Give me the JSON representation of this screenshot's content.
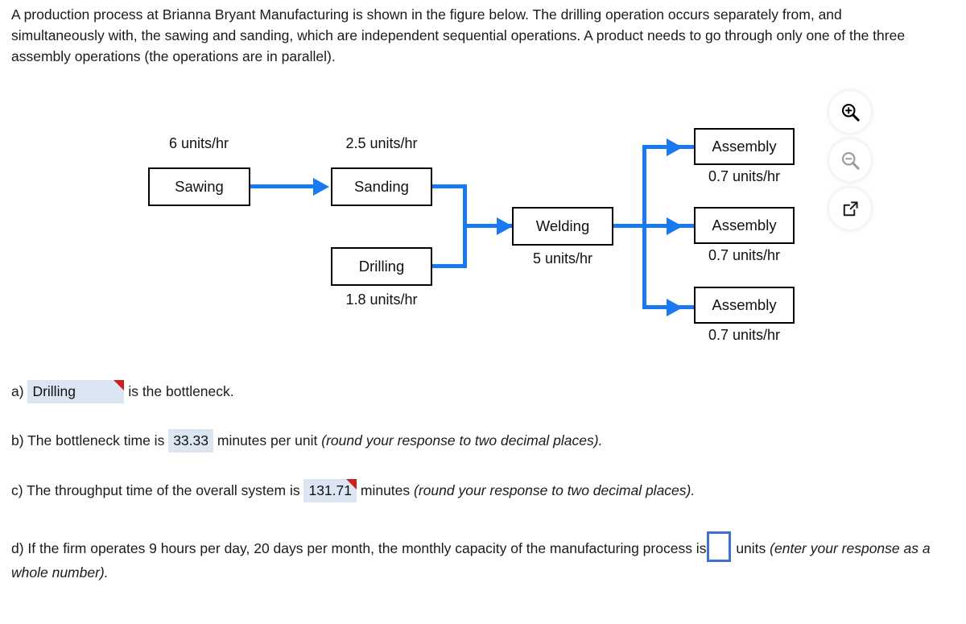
{
  "problem": {
    "statement": "A production process at Brianna Bryant Manufacturing is shown in the figure below. The drilling operation occurs separately from, and simultaneously with, the sawing and sanding, which are independent sequential operations. A product needs to go through only one of the three assembly operations (the operations are in parallel)."
  },
  "figure": {
    "accent_color": "#1879f1",
    "nodes": [
      {
        "id": "sawing",
        "label": "Sawing",
        "rate": "6 units/hr",
        "rate_position": "above"
      },
      {
        "id": "sanding",
        "label": "Sanding",
        "rate": "2.5 units/hr",
        "rate_position": "above"
      },
      {
        "id": "drilling",
        "label": "Drilling",
        "rate": "1.8 units/hr",
        "rate_position": "below"
      },
      {
        "id": "welding",
        "label": "Welding",
        "rate": "5 units/hr",
        "rate_position": "below"
      },
      {
        "id": "assembly1",
        "label": "Assembly",
        "rate": "0.7 units/hr",
        "rate_position": "below"
      },
      {
        "id": "assembly2",
        "label": "Assembly",
        "rate": "0.7 units/hr",
        "rate_position": "below"
      },
      {
        "id": "assembly3",
        "label": "Assembly",
        "rate": "0.7 units/hr",
        "rate_position": "below"
      }
    ],
    "tools": [
      {
        "id": "zoom-in",
        "icon": "magnifier-plus-icon",
        "state": "enabled"
      },
      {
        "id": "zoom-out",
        "icon": "magnifier-minus-icon",
        "state": "disabled"
      },
      {
        "id": "open-full",
        "icon": "external-link-icon",
        "state": "enabled"
      }
    ]
  },
  "answers": {
    "a": {
      "prefix": "a)",
      "field_value": "Drilling",
      "suffix": "is the bottleneck.",
      "flagged": true
    },
    "b": {
      "prefix": "b) The bottleneck time is",
      "field_value": "33.33",
      "suffix": "minutes per unit",
      "hint": "(round your response to two decimal places).",
      "flagged": false
    },
    "c": {
      "prefix": "c) The throughput time of the overall system is",
      "field_value": "131.71",
      "suffix": "minutes",
      "hint": "(round your response to two decimal places).",
      "flagged": true
    },
    "d": {
      "prefix": "d) If the firm operates 9 hours per day, 20 days per month, the monthly capacity of the manufacturing process is",
      "field_value": "",
      "field_placeholder": "",
      "suffix": "units",
      "hint": "(enter your response as a whole number)."
    }
  }
}
